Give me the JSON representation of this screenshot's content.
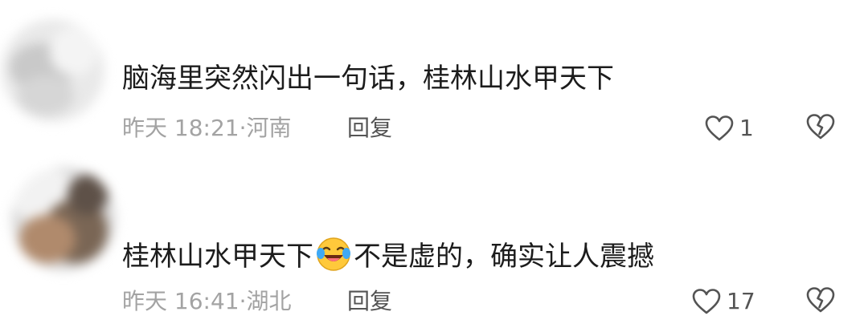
{
  "comments": [
    {
      "text": "脑海里突然闪出一句话，桂林山水甲天下",
      "time": "昨天 18:21",
      "location": "河南",
      "reply_label": "回复",
      "likes": "1"
    },
    {
      "text_before": "桂林山水甲天下",
      "emoji": "laughing-crying-emoji",
      "text_after": "不是虚的，确实让人震撼",
      "time": "昨天 16:41",
      "location": "湖北",
      "reply_label": "回复",
      "likes": "17"
    }
  ],
  "separator": "·",
  "icons": {
    "like": "heart-outline-icon",
    "dislike": "broken-heart-icon"
  },
  "colors": {
    "text": "#1c1c1c",
    "meta": "#a3a3a3",
    "action": "#545454"
  }
}
